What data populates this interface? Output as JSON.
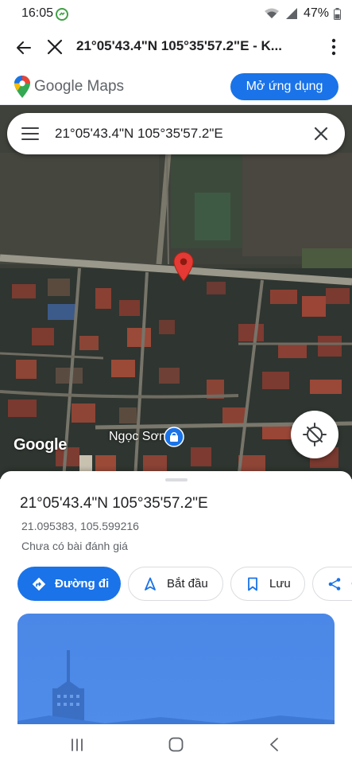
{
  "status_bar": {
    "time": "16:05",
    "battery": "47%"
  },
  "browser": {
    "title": "21°05'43.4\"N 105°35'57.2\"E - K..."
  },
  "maps_header": {
    "logo_text": "Google Maps",
    "open_app_label": "Mở ứng dụng"
  },
  "map": {
    "search_text": "21°05'43.4\"N 105°35'57.2\"E",
    "watermark": "Google",
    "place_label": "Ngọc Sơn"
  },
  "sheet": {
    "title": "21°05'43.4\"N 105°35'57.2\"E",
    "decimal_coords": "21.095383, 105.599216",
    "review_text": "Chưa có bài đánh giá",
    "actions": {
      "directions": "Đường đi",
      "start": "Bắt đầu",
      "save": "Lưu",
      "share": "C"
    }
  },
  "icons": {
    "status_app": "messenger-icon",
    "browser_back": "arrow-left-icon",
    "browser_close": "close-icon",
    "browser_menu": "more-vert-icon",
    "maps_logo": "maps-pin-icon",
    "search_menu": "hamburger-icon",
    "search_clear": "close-icon",
    "map_pin": "location-pin-icon",
    "place": "shopping-bag-icon",
    "locate": "my-location-icon",
    "directions": "directions-icon",
    "start": "navigation-arrow-icon",
    "save": "bookmark-icon",
    "share": "share-icon"
  },
  "colors": {
    "accent": "#1a73e8",
    "pin_red": "#e53935"
  }
}
